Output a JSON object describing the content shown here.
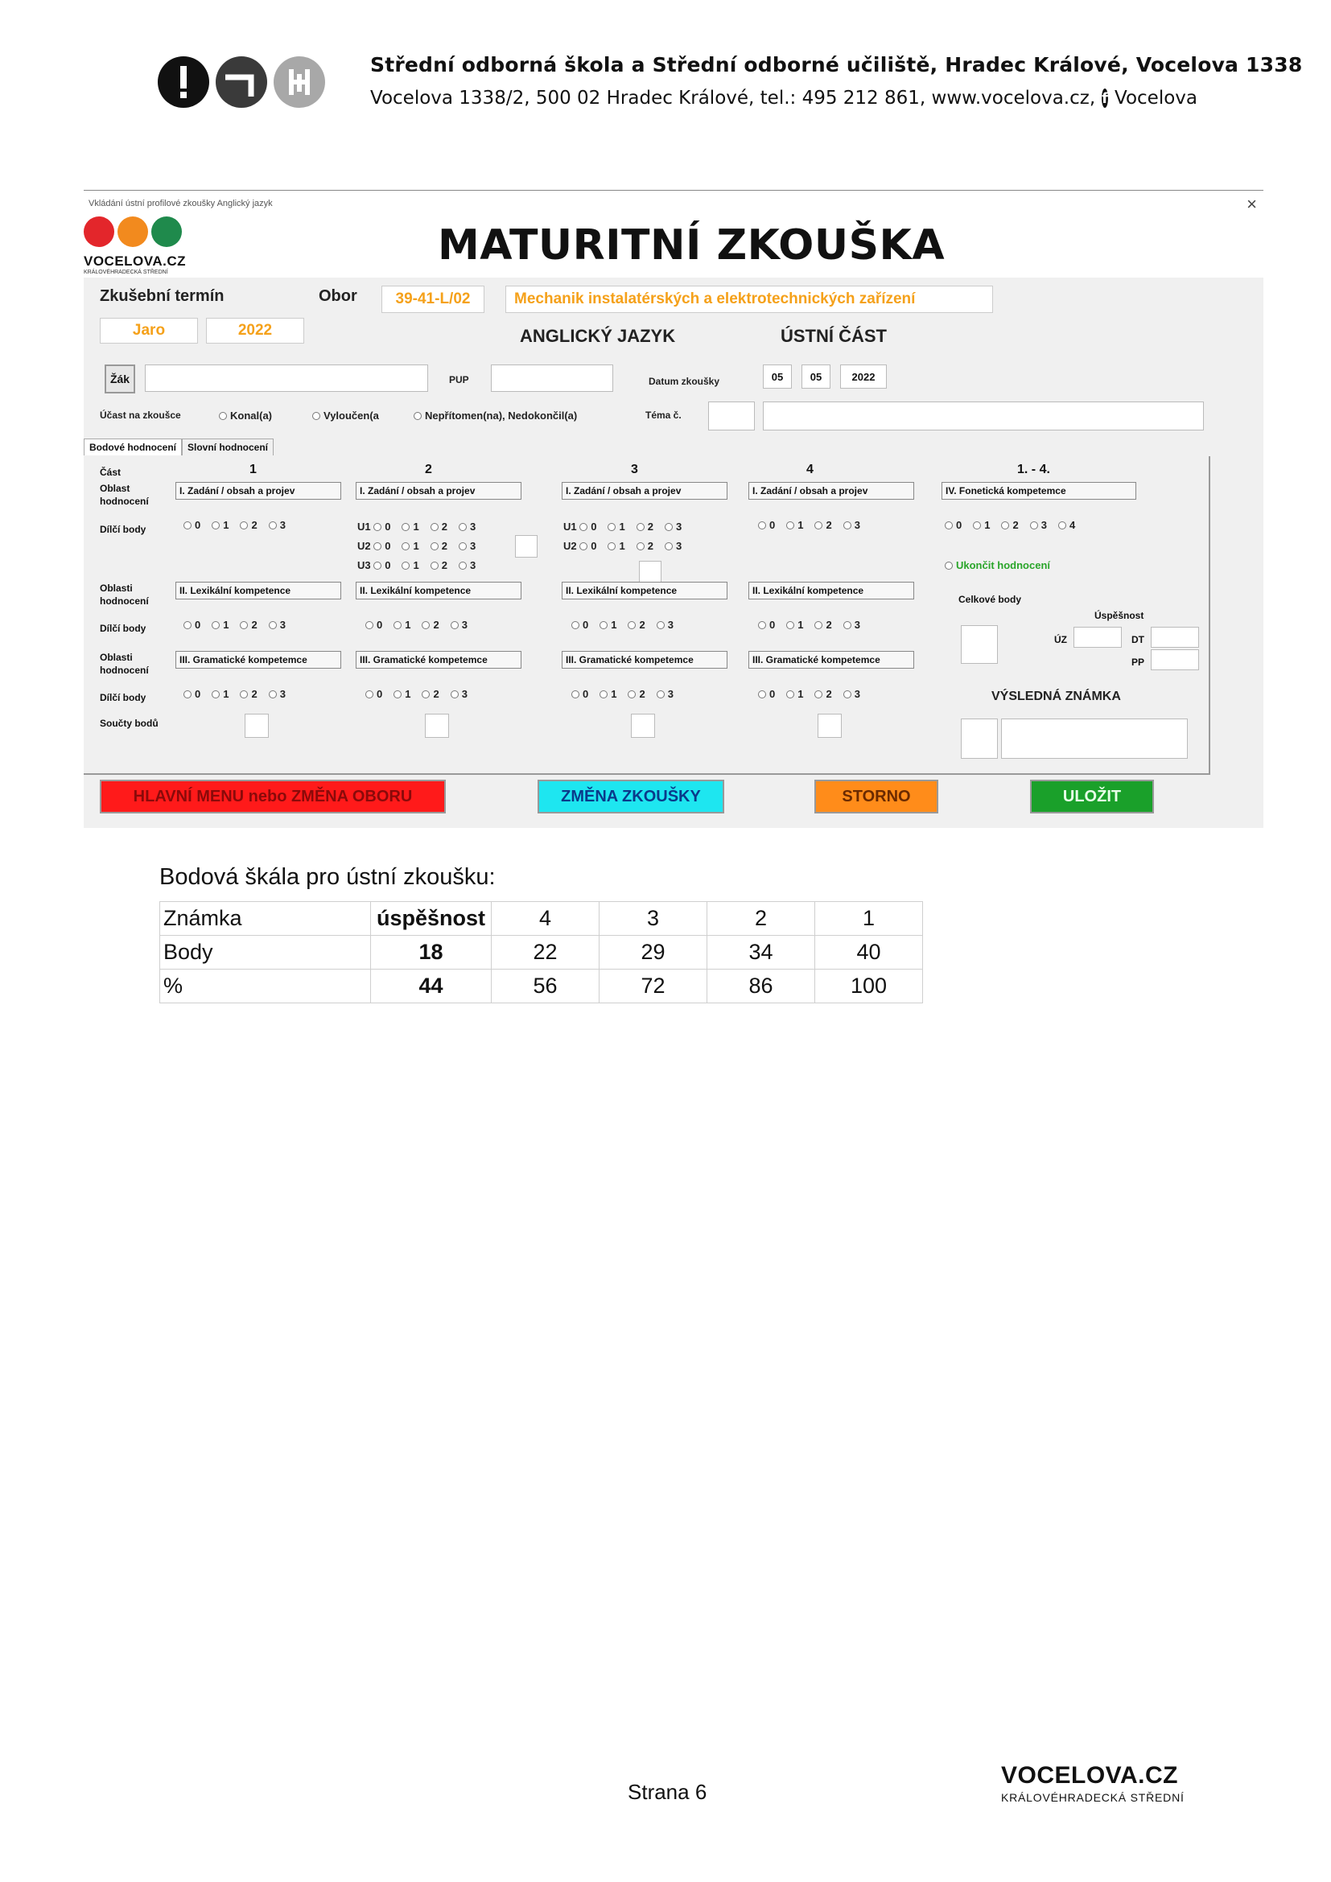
{
  "header": {
    "school_name": "Střední odborná škola a Střední odborné učiliště, Hradec Králové, Vocelova 1338",
    "address_line": "Vocelova 1338/2, 500 02 Hradec Králové, tel.: 495 212 861, www.vocelova.cz,",
    "facebook_label": "Vocelova",
    "colors": {
      "red": "#e3262b",
      "dark": "#3a3a3a",
      "gray": "#a8a8a8"
    }
  },
  "window": {
    "title": "Vkládání ústní profilové zkoušky  Anglický jazyk",
    "close": "×",
    "brand": "VOCELOVA.CZ",
    "brand_sub": "KRÁLOVÉHRADECKÁ STŘEDNÍ",
    "main_title": "MATURITNÍ ZKOUŠKA",
    "logo_colors": [
      "#e3262b",
      "#f28a1e",
      "#1f8a4c"
    ]
  },
  "form": {
    "term_label": "Zkušební termín",
    "obor_label": "Obor",
    "obor_code": "39-41-L/02",
    "obor_name": "Mechanik instalatérských a elektrotechnických zařízení",
    "term_season": "Jaro",
    "term_year": "2022",
    "subject": "ANGLICKÝ JAZYK",
    "part": "ÚSTNÍ ČÁST",
    "zak_button": "Žák",
    "pup_label": "PUP",
    "date_label": "Datum zkoušky",
    "date_day": "05",
    "date_month": "05",
    "date_year": "2022",
    "attendance_label": "Účast na zkoušce",
    "attendance_options": [
      "Konal(a)",
      "Vyloučen(a",
      "Nepřítomen(na), Nedokončil(a)"
    ],
    "topic_label": "Téma č.",
    "tabs": [
      "Bodové hodnocení",
      "Slovní hodnocení"
    ],
    "part_label": "Část",
    "area_label": "Oblast hodnocení",
    "area_label_2": "Oblasti hodnocení",
    "partial_label": "Dílčí body",
    "sum_label": "Součty bodů",
    "columns": [
      "1",
      "2",
      "3",
      "4",
      "1. - 4."
    ],
    "area1": "I.  Zadání / obsah a projev",
    "area2": "II.  Lexikální kompetence",
    "area3": "III. Gramatické kompetemce",
    "area4": "IV.  Fonetická kompetemce",
    "points_0_3": [
      "0",
      "1",
      "2",
      "3"
    ],
    "points_0_4": [
      "0",
      "1",
      "2",
      "3",
      "4"
    ],
    "sub_rows": [
      "U1",
      "U2",
      "U3"
    ],
    "finish_label": "Ukončit hodnocení",
    "total_label": "Celkové body",
    "success_label": "Úspěšnost",
    "uz_label": "ÚZ",
    "dt_label": "DT",
    "pp_label": "PP",
    "grade_label": "VÝSLEDNÁ ZNÁMKA",
    "btn_menu": "HLAVNÍ MENU nebo  ZMĚNA OBORU",
    "btn_change": "ZMĚNA ZKOUŠKY",
    "btn_cancel": "STORNO",
    "btn_save": "ULOŽIT",
    "btn_colors": {
      "menu": "#ff1a1a",
      "change": "#1ee6f0",
      "cancel": "#ff8c1a",
      "save": "#1aa02a"
    }
  },
  "scale": {
    "caption": "Bodová škála pro ústní zkoušku:",
    "rows": [
      [
        "Známka",
        "úspěšnost",
        "4",
        "3",
        "2",
        "1"
      ],
      [
        "Body",
        "18",
        "22",
        "29",
        "34",
        "40"
      ],
      [
        "%",
        "44",
        "56",
        "72",
        "86",
        "100"
      ]
    ]
  },
  "footer": {
    "page": "Strana 6",
    "brand": "VOCELOVA.CZ",
    "brand_sub": "KRÁLOVÉHRADECKÁ STŘEDNÍ"
  }
}
